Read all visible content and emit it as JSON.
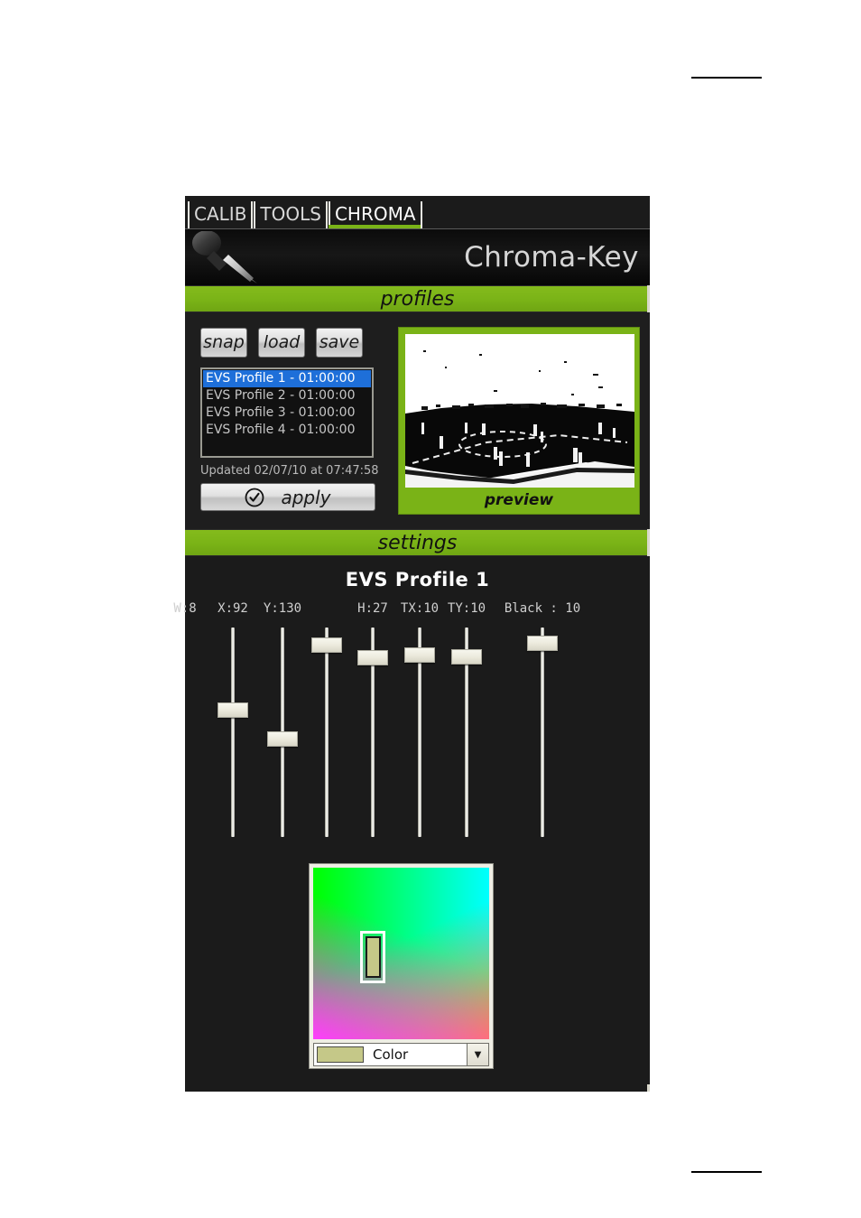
{
  "window": {
    "title": "Chroma-Key",
    "eyedropper_icon": "eyedropper-icon"
  },
  "tabs": [
    {
      "label": "CALIB",
      "active": false
    },
    {
      "label": "TOOLS",
      "active": false
    },
    {
      "label": "CHROMA",
      "active": true
    }
  ],
  "sections": {
    "profiles_title": "profiles",
    "settings_title": "settings"
  },
  "profiles": {
    "buttons": [
      {
        "label": "snap",
        "name": "snap-button"
      },
      {
        "label": "load",
        "name": "load-button"
      },
      {
        "label": "save",
        "name": "save-button"
      }
    ],
    "list": [
      {
        "label": "EVS Profile 1 - 01:00:00",
        "selected": true
      },
      {
        "label": "EVS Profile 2 - 01:00:00",
        "selected": false
      },
      {
        "label": "EVS Profile 3 - 01:00:00",
        "selected": false
      },
      {
        "label": "EVS Profile 4 - 01:00:00",
        "selected": false
      }
    ],
    "updated_text": "Updated 02/07/10 at 07:47:58",
    "apply_label": "apply",
    "apply_icon": "check-circle-icon"
  },
  "preview": {
    "caption": "preview"
  },
  "settings": {
    "profile_name": "EVS Profile 1",
    "sliders": [
      {
        "name": "x",
        "label": "X:92",
        "value": 92,
        "handle_pct": 38
      },
      {
        "name": "y",
        "label": "Y:130",
        "value": 130,
        "handle_pct": 57
      },
      {
        "name": "w",
        "label": "W:8",
        "value": 8,
        "handle_pct": 7
      },
      {
        "name": "h",
        "label": "H:27",
        "value": 27,
        "handle_pct": 26
      },
      {
        "name": "tx",
        "label": "TX:10",
        "value": 10,
        "handle_pct": 23
      },
      {
        "name": "ty",
        "label": "TY:10",
        "value": 10,
        "handle_pct": 24
      },
      {
        "name": "black",
        "label": "Black : 10",
        "value": 10,
        "handle_pct": 9
      }
    ]
  },
  "color_picker": {
    "combo_label": "Color",
    "swatch_color": "#c5c888",
    "gradient": {
      "top_left": "#00ff00",
      "top_right": "#00ffff",
      "bottom_left": "#ff9614",
      "bottom_right": "#ff3cff"
    },
    "dropdown_icon": "chevron-down-icon"
  },
  "theme": {
    "accent_green": "#7ab317",
    "window_bg": "#1b1b1b",
    "selection_blue": "#1e6fd9"
  }
}
